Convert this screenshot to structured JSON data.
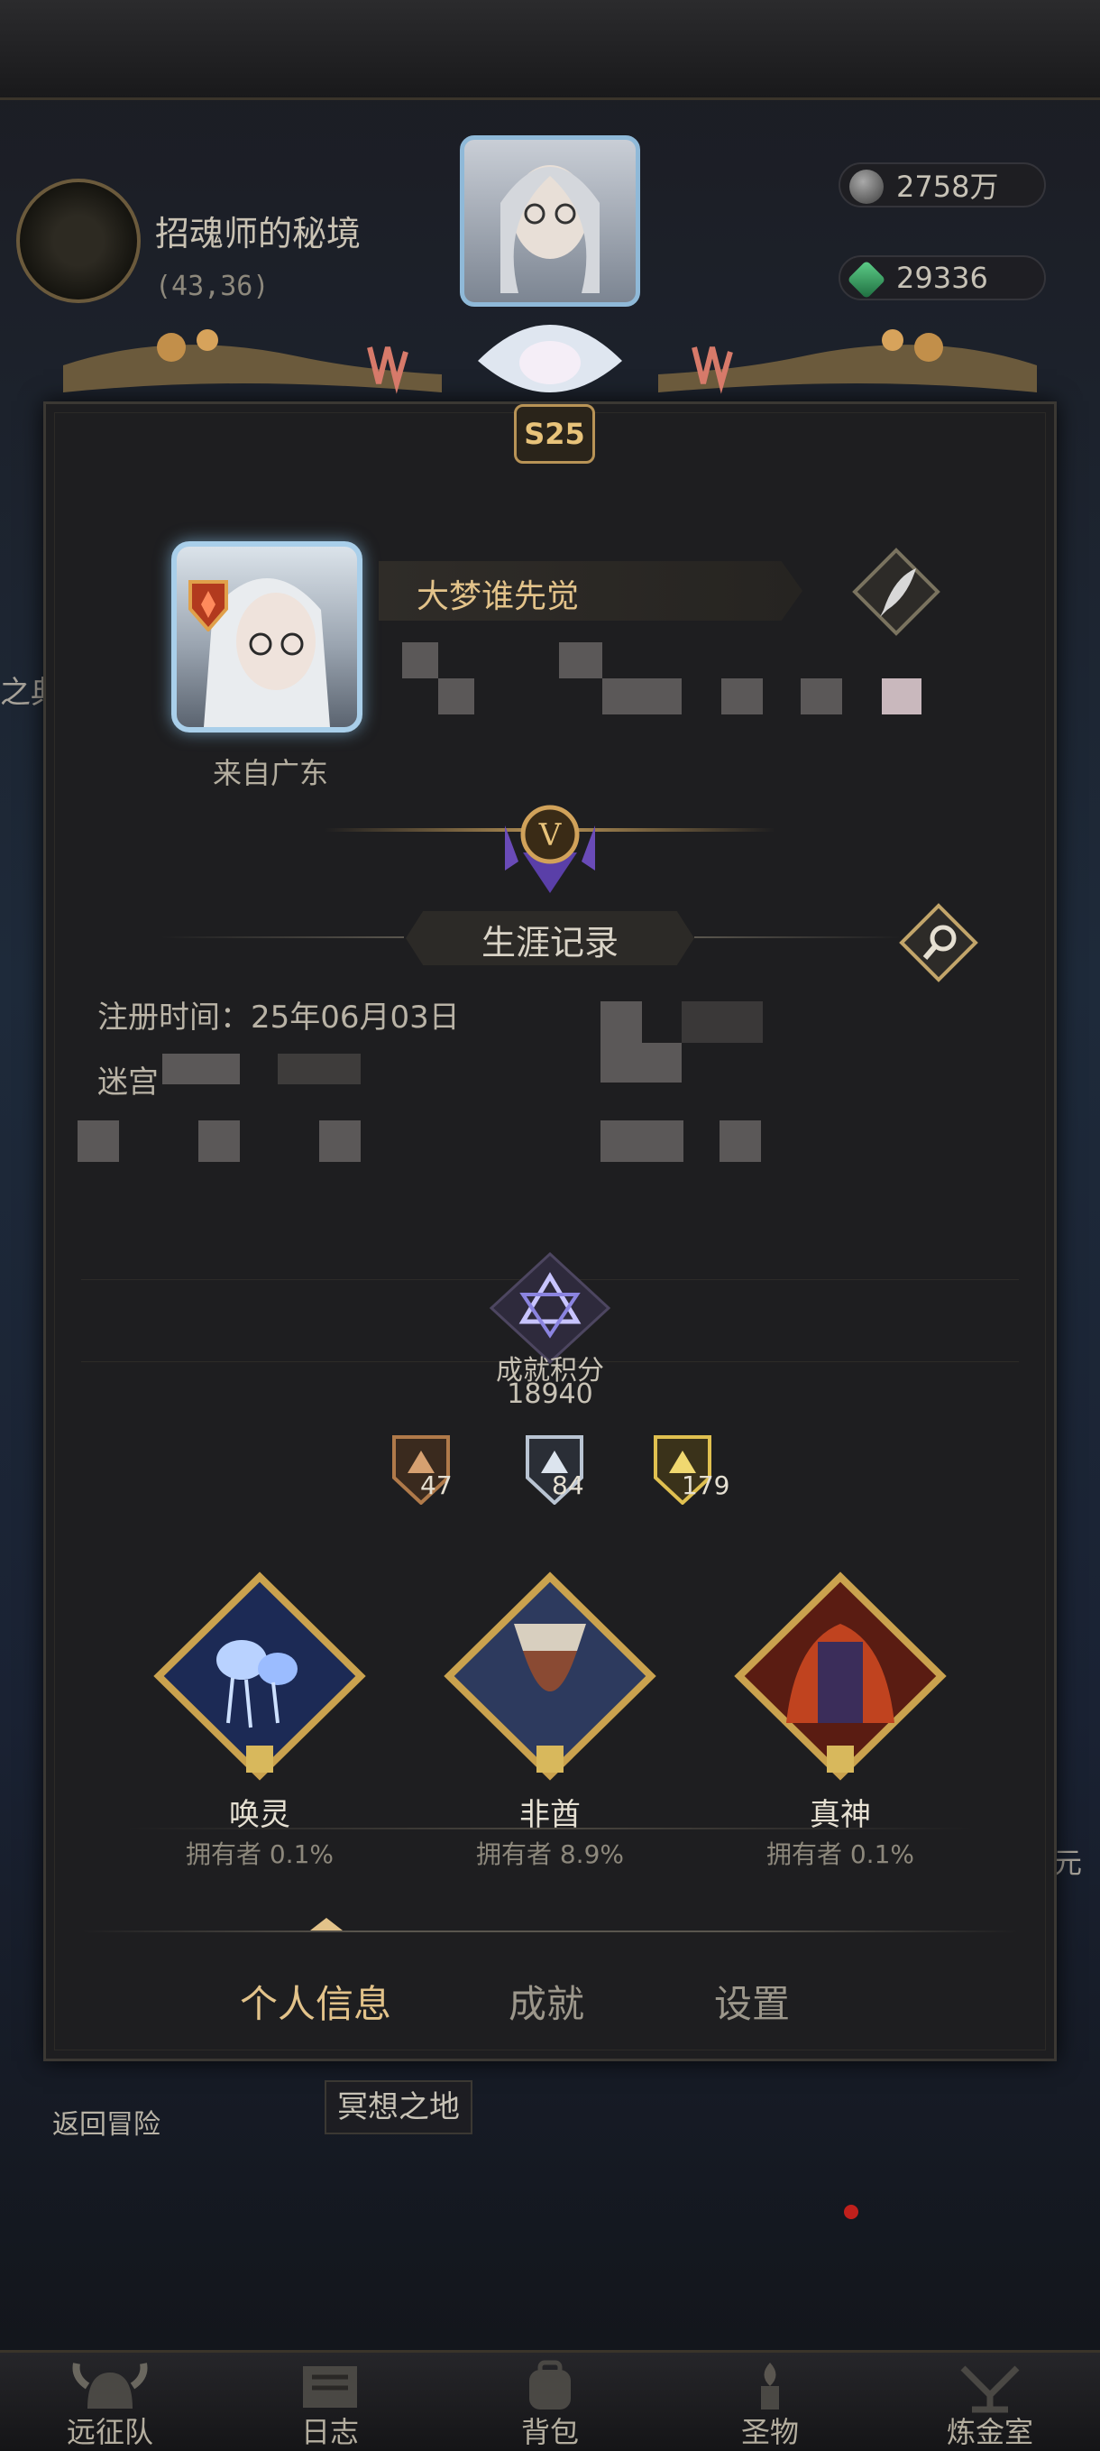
{
  "background": {
    "location_name": "招魂师的秘境",
    "location_coords": "(43,36)",
    "resources": [
      {
        "icon": "silver-stone-icon",
        "value": "2758万"
      },
      {
        "icon": "green-gem-icon",
        "value": "29336"
      }
    ],
    "side_left_text": "之典",
    "side_right_text": "元",
    "back_to_adventure": "返回冒险",
    "meditation_land": "冥想之地"
  },
  "panel": {
    "season_badge": "S25",
    "profile": {
      "player_name": "大梦谁先觉",
      "origin": "来自广东"
    },
    "career": {
      "title": "生涯记录",
      "registration": "注册时间：25年06月03日",
      "cut_label": "迷宫"
    },
    "achievement": {
      "label": "成就积分",
      "score": "18940",
      "medals": [
        {
          "tier": "bronze",
          "count": "47"
        },
        {
          "tier": "silver",
          "count": "84"
        },
        {
          "tier": "gold",
          "count": "179"
        }
      ]
    },
    "badges": [
      {
        "name": "唤灵",
        "owners": "拥有者 0.1%"
      },
      {
        "name": "非酋",
        "owners": "拥有者 8.9%"
      },
      {
        "name": "真神",
        "owners": "拥有者 0.1%"
      }
    ],
    "tabs": [
      {
        "label": "个人信息",
        "active": true
      },
      {
        "label": "成就",
        "active": false
      },
      {
        "label": "设置",
        "active": false
      }
    ]
  },
  "nav": [
    {
      "label": "远征队",
      "icon": "viking-helmet-icon"
    },
    {
      "label": "日志",
      "icon": "scroll-log-icon"
    },
    {
      "label": "背包",
      "icon": "backpack-icon"
    },
    {
      "label": "圣物",
      "icon": "torch-relic-icon"
    },
    {
      "label": "炼金室",
      "icon": "alchemy-icon"
    }
  ],
  "colors": {
    "accent_gold": "#e3c38a",
    "panel_bg": "#1e1e20",
    "text_muted": "#8d887c"
  }
}
